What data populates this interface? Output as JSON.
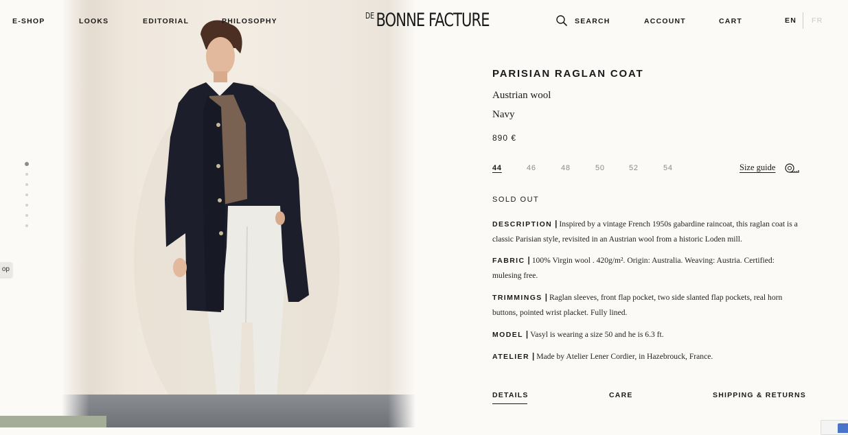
{
  "nav": {
    "left": [
      "E-SHOP",
      "LOOKS",
      "EDITORIAL",
      "PHILOSOPHY"
    ],
    "logo_de": "DE",
    "logo_main": "BONNE FACTURE",
    "search_label": "SEARCH",
    "account_label": "ACCOUNT",
    "cart_label": "CART",
    "lang_en": "EN",
    "lang_fr": "FR"
  },
  "side_tab_label": "op",
  "product": {
    "title": "PARISIAN RAGLAN COAT",
    "material": "Austrian wool",
    "color": "Navy",
    "price": "890 €",
    "sizes": [
      "44",
      "46",
      "48",
      "50",
      "52",
      "54"
    ],
    "selected_size": "44",
    "size_guide_label": "Size guide",
    "stock_status": "SOLD OUT",
    "details": [
      {
        "key": "DESCRIPTION",
        "text": "Inspired by a vintage French 1950s gabardine raincoat, this raglan coat is a classic Parisian style, revisited in an Austrian wool from a historic Loden mill."
      },
      {
        "key": "FABRIC",
        "text": "100% Virgin wool . 420g/m². Origin: Australia. Weaving: Austria. Certified: mulesing free."
      },
      {
        "key": "TRIMMINGS",
        "text": "Raglan sleeves, front flap pocket, two side slanted flap pockets, real horn buttons, pointed wrist placket. Fully lined."
      },
      {
        "key": "MODEL",
        "text": "Vasyl is wearing a size 50 and he is 6.3 ft."
      },
      {
        "key": "ATELIER",
        "text": "Made by Atelier Lener Cordier, in Hazebrouck, France."
      }
    ],
    "tabs": [
      "DETAILS",
      "CARE",
      "SHIPPING & RETURNS"
    ]
  },
  "carousel": {
    "count": 7,
    "active_index": 0
  },
  "colors": {
    "ink": "#1a1a1a",
    "page_bg": "#fcfaf7",
    "muted": "#8a8a8a",
    "coat": "#1c1f2b",
    "sweater": "#7a6252",
    "trousers": "#ecebe6"
  },
  "icons": [
    "search-icon",
    "measuring-tape-icon"
  ]
}
